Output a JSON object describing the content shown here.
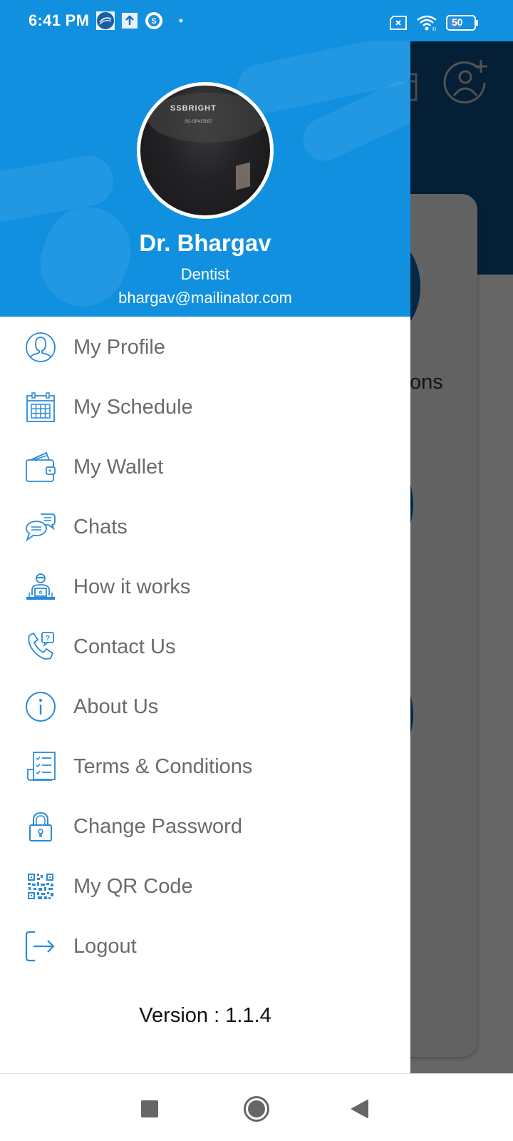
{
  "status_bar": {
    "time": "6:41 PM",
    "battery_level": "50",
    "icons_left": [
      "app-notification-icon",
      "upload-icon",
      "skype-icon",
      "dot-icon"
    ],
    "icons_right": [
      "sim-off-icon",
      "wifi-icon",
      "battery-icon"
    ]
  },
  "drawer": {
    "profile": {
      "name": "Dr. Bhargav",
      "role": "Dentist",
      "email": "bhargav@mailinator.com",
      "avatar_text": "SSBRIGHT",
      "avatar_subtext": "SG-SP415087"
    },
    "menu": [
      {
        "label": "My Profile",
        "icon": "user-profile-icon"
      },
      {
        "label": "My Schedule",
        "icon": "calendar-icon"
      },
      {
        "label": "My Wallet",
        "icon": "wallet-icon"
      },
      {
        "label": "Chats",
        "icon": "chat-bubbles-icon"
      },
      {
        "label": "How it works",
        "icon": "person-laptop-icon"
      },
      {
        "label": "Contact Us",
        "icon": "phone-question-icon"
      },
      {
        "label": "About Us",
        "icon": "info-icon"
      },
      {
        "label": "Terms & Conditions",
        "icon": "checklist-icon"
      },
      {
        "label": "Change Password",
        "icon": "lock-icon"
      },
      {
        "label": "My QR Code",
        "icon": "qr-code-icon"
      },
      {
        "label": "Logout",
        "icon": "logout-icon"
      }
    ],
    "version": "Version : 1.1.4"
  },
  "background": {
    "partial_texts": [
      "ons",
      "s"
    ]
  },
  "nav_bar": {
    "buttons": [
      "recents",
      "home",
      "back"
    ]
  },
  "colors": {
    "accent": "#1190e0",
    "icon": "#1a7fd1",
    "menu_text": "#6b6b6b",
    "background_header": "#0a4f87"
  }
}
